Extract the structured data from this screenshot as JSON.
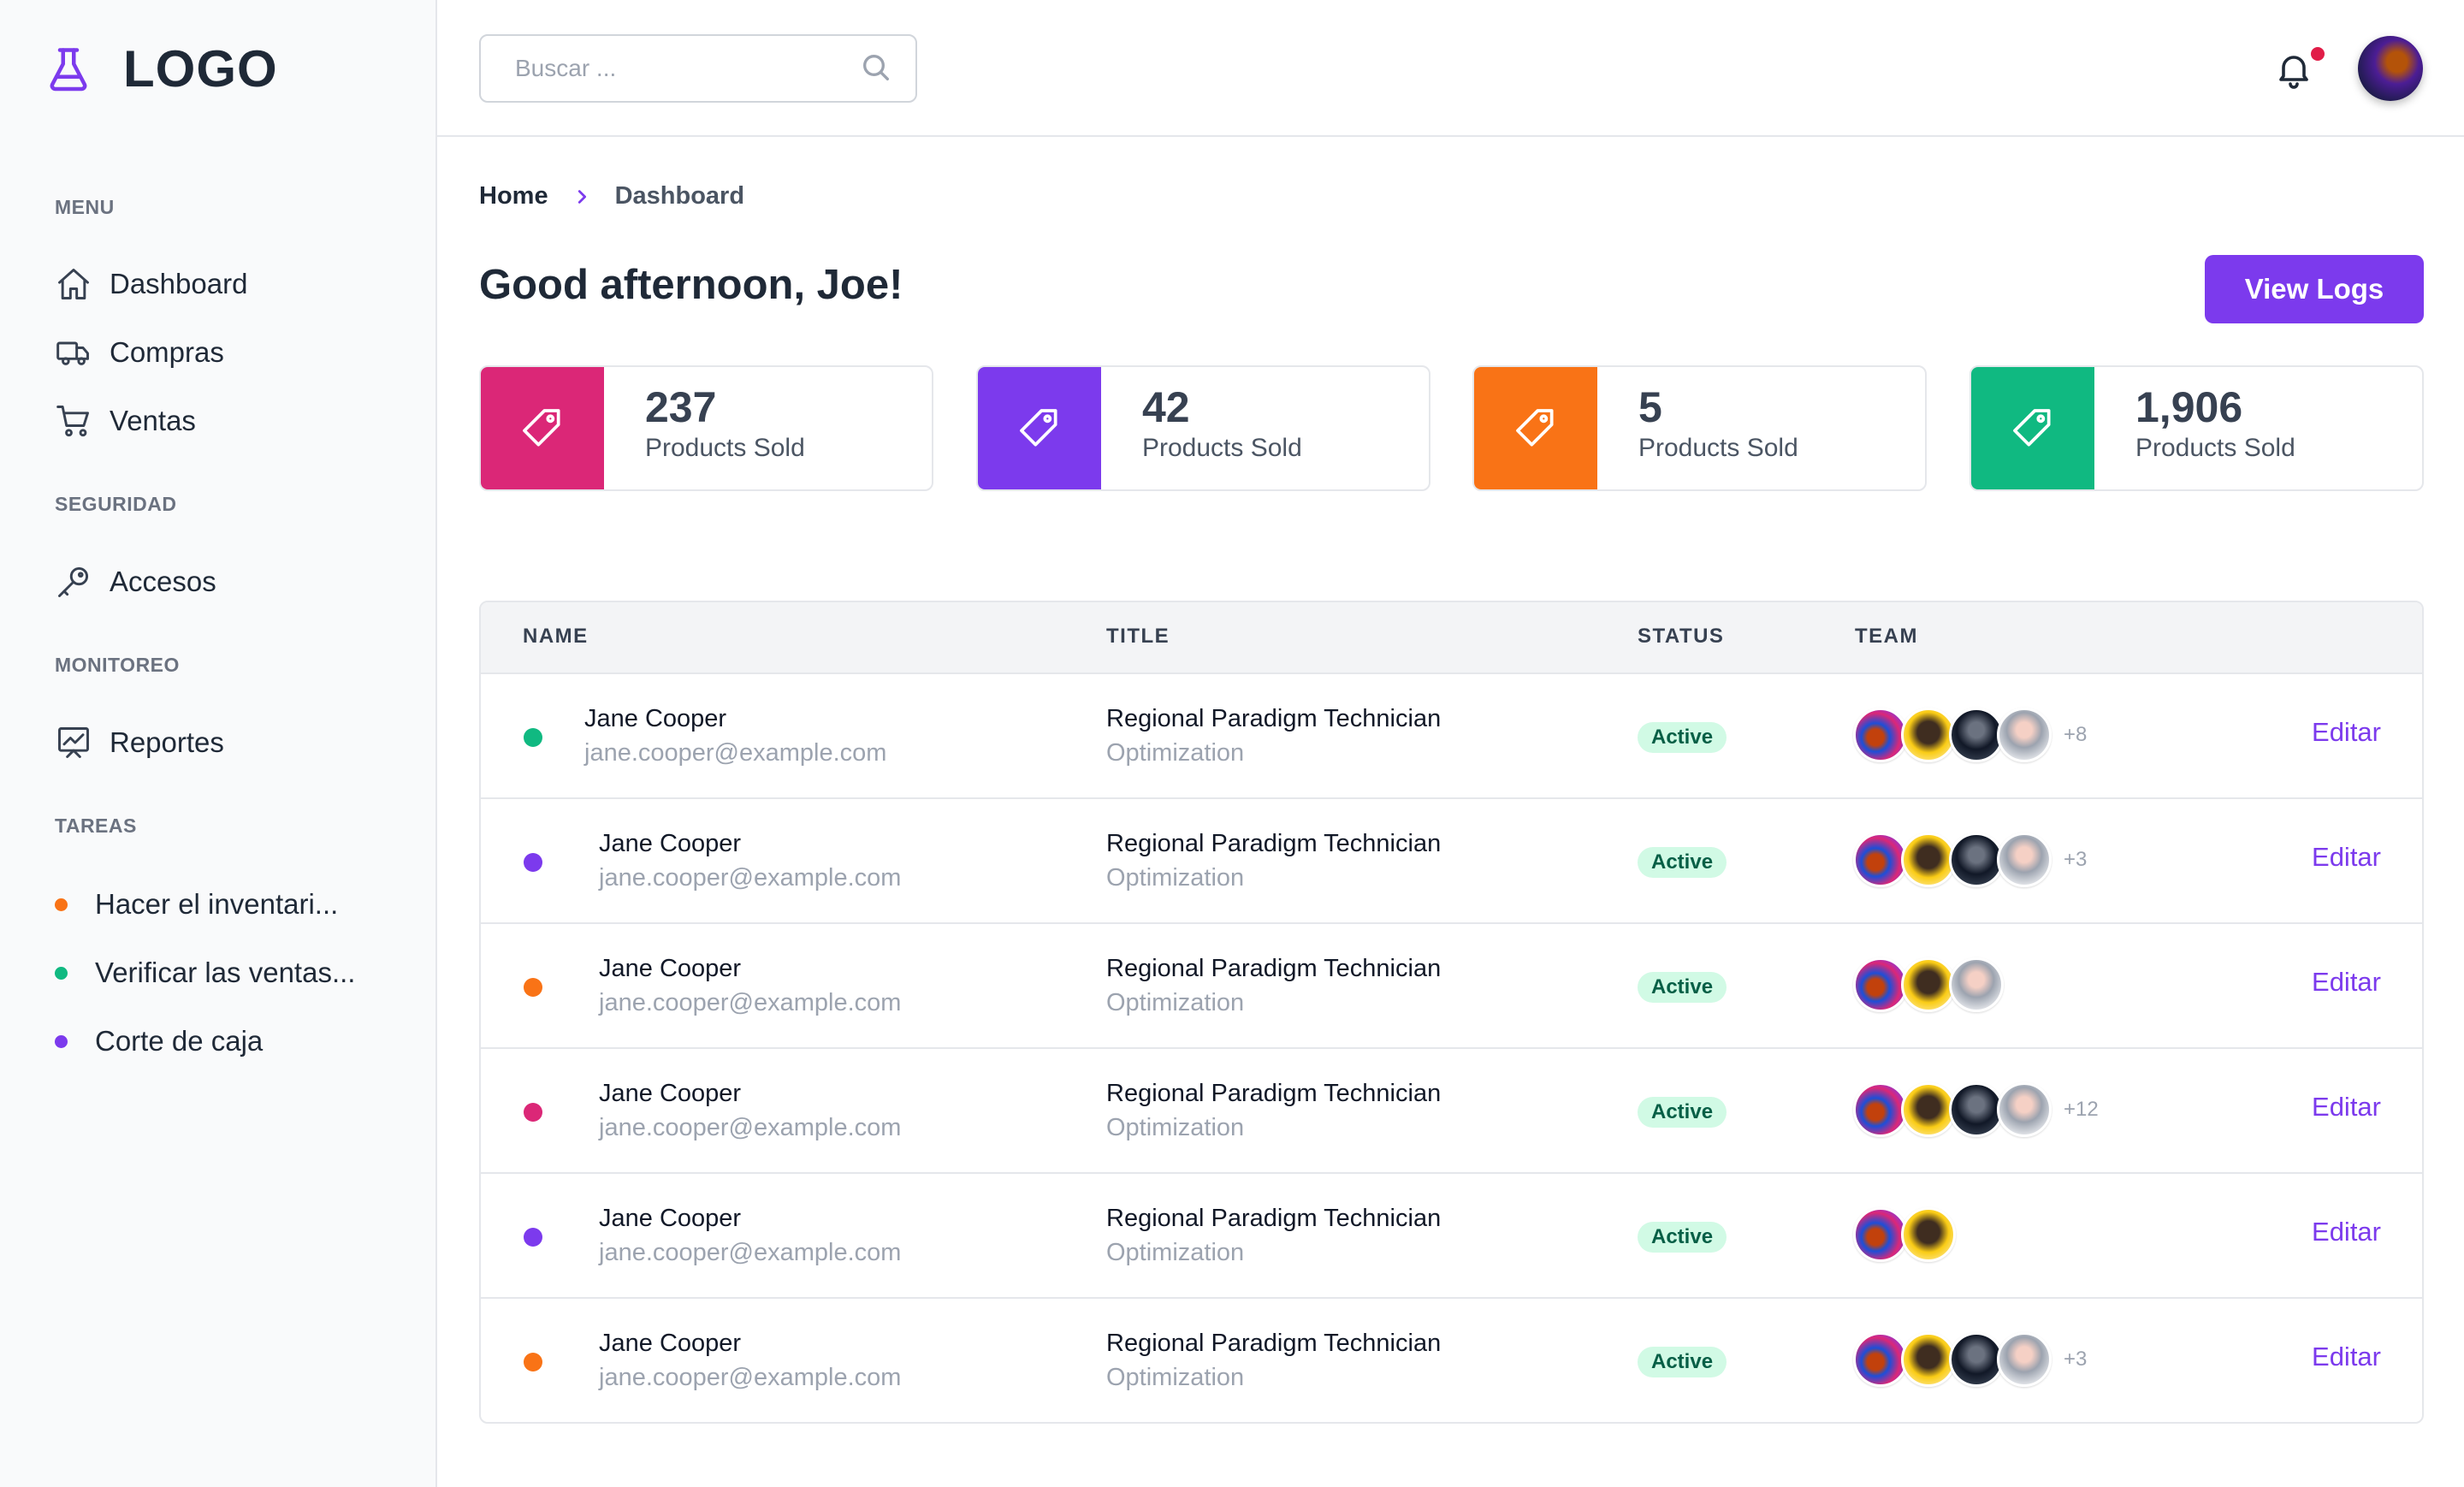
{
  "brand": {
    "logo_text": "LOGO",
    "accent": "#7c3aed"
  },
  "sidebar": {
    "sections": [
      {
        "title": "MENU"
      },
      {
        "title": "SEGURIDAD"
      },
      {
        "title": "MONITOREO"
      },
      {
        "title": "TAREAS"
      }
    ],
    "menu_items": [
      {
        "label": "Dashboard",
        "icon": "home-icon"
      },
      {
        "label": "Compras",
        "icon": "truck-icon"
      },
      {
        "label": "Ventas",
        "icon": "cart-icon"
      }
    ],
    "security_items": [
      {
        "label": "Accesos",
        "icon": "key-icon"
      }
    ],
    "monitor_items": [
      {
        "label": "Reportes",
        "icon": "chart-icon"
      }
    ],
    "tasks": [
      {
        "label": "Hacer el inventari...",
        "color": "#f97316"
      },
      {
        "label": "Verificar las ventas...",
        "color": "#10b981"
      },
      {
        "label": "Corte de caja",
        "color": "#7c3aed"
      }
    ]
  },
  "header": {
    "search_placeholder": "Buscar ...",
    "notification_dot_color": "#e11d48"
  },
  "breadcrumb": {
    "home": "Home",
    "current": "Dashboard"
  },
  "greeting": "Good afternoon, Joe!",
  "view_logs_label": "View Logs",
  "stats": [
    {
      "value": "237",
      "label": "Products Sold",
      "color": "#db2777"
    },
    {
      "value": "42",
      "label": "Products Sold",
      "color": "#7c3aed"
    },
    {
      "value": "5",
      "label": "Products Sold",
      "color": "#f97316"
    },
    {
      "value": "1,906",
      "label": "Products Sold",
      "color": "#10b981"
    }
  ],
  "table": {
    "headers": {
      "name": "NAME",
      "title": "TITLE",
      "status": "STATUS",
      "team": "TEAM"
    },
    "edit_label": "Editar",
    "rows": [
      {
        "dot_color": "#10b981",
        "name": "Jane Cooper",
        "email": "jane.cooper@example.com",
        "title": "Regional Paradigm Technician",
        "subtitle": "Optimization",
        "status": "Active",
        "team_count": 4,
        "more": "+8"
      },
      {
        "dot_color": "#7c3aed",
        "name": "Jane Cooper",
        "email": "jane.cooper@example.com",
        "title": "Regional Paradigm Technician",
        "subtitle": "Optimization",
        "status": "Active",
        "team_count": 4,
        "more": "+3"
      },
      {
        "dot_color": "#f97316",
        "name": "Jane Cooper",
        "email": "jane.cooper@example.com",
        "title": "Regional Paradigm Technician",
        "subtitle": "Optimization",
        "status": "Active",
        "team_count": 3,
        "more": ""
      },
      {
        "dot_color": "#db2777",
        "name": "Jane Cooper",
        "email": "jane.cooper@example.com",
        "title": "Regional Paradigm Technician",
        "subtitle": "Optimization",
        "status": "Active",
        "team_count": 4,
        "more": "+12"
      },
      {
        "dot_color": "#7c3aed",
        "name": "Jane Cooper",
        "email": "jane.cooper@example.com",
        "title": "Regional Paradigm Technician",
        "subtitle": "Optimization",
        "status": "Active",
        "team_count": 2,
        "more": ""
      },
      {
        "dot_color": "#f97316",
        "name": "Jane Cooper",
        "email": "jane.cooper@example.com",
        "title": "Regional Paradigm Technician",
        "subtitle": "Optimization",
        "status": "Active",
        "team_count": 4,
        "more": "+3"
      }
    ]
  }
}
